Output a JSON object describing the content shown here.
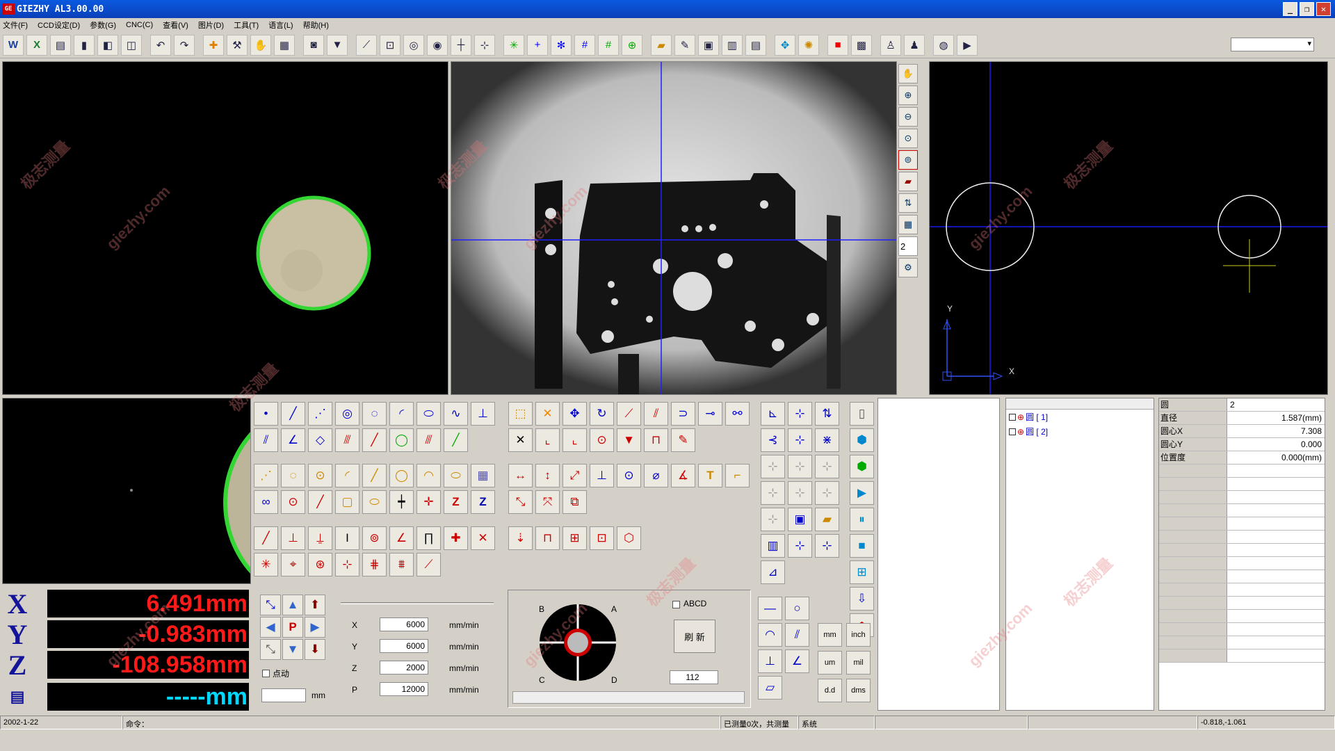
{
  "window": {
    "title": "GIEZHY AL3.00.00",
    "logo": "GE"
  },
  "menu": [
    "文件(F)",
    "CCD设定(D)",
    "参数(G)",
    "CNC(C)",
    "查看(V)",
    "图片(D)",
    "工具(T)",
    "语言(L)",
    "帮助(H)"
  ],
  "readout": {
    "x_label": "X",
    "y_label": "Y",
    "z_label": "Z",
    "x": "6.491mm",
    "y": "-0.983mm",
    "z": "-108.958mm",
    "probe": "-----mm"
  },
  "cnc": {
    "x_speed": "6000",
    "y_speed": "6000",
    "z_speed": "2000",
    "p_speed": "12000",
    "unit": "mm/min",
    "x_label": "X",
    "y_label": "Y",
    "z_label": "Z",
    "p_label": "P",
    "point_check": "点动",
    "step_unit": "mm",
    "p_button": "P"
  },
  "joystick": {
    "a": "A",
    "b": "B",
    "c": "C",
    "d": "D",
    "abcd_check": "ABCD",
    "refresh": "刷 新",
    "value": "112"
  },
  "units": [
    "mm",
    "inch",
    "um",
    "mil",
    "d.d",
    "dms"
  ],
  "feature_list": [
    "圆 [ 1]",
    "圆 [ 2]"
  ],
  "properties": {
    "header_key": "圆",
    "header_val": "2",
    "rows": [
      {
        "k": "直径",
        "v": "1.587(mm)"
      },
      {
        "k": "圆心X",
        "v": "7.308"
      },
      {
        "k": "圆心Y",
        "v": "0.000"
      },
      {
        "k": "位置度",
        "v": "0.000(mm)"
      }
    ]
  },
  "drawing": {
    "x_axis": "X",
    "y_axis": "Y"
  },
  "zoom_field": "2",
  "status": {
    "date": "2002-1-22",
    "command": "命令：",
    "measured": "已测量0次，共测量",
    "system": "系统",
    "coords": "-0.818,-1.061"
  },
  "watermarks": [
    "giezhy.com",
    "极志测量"
  ]
}
